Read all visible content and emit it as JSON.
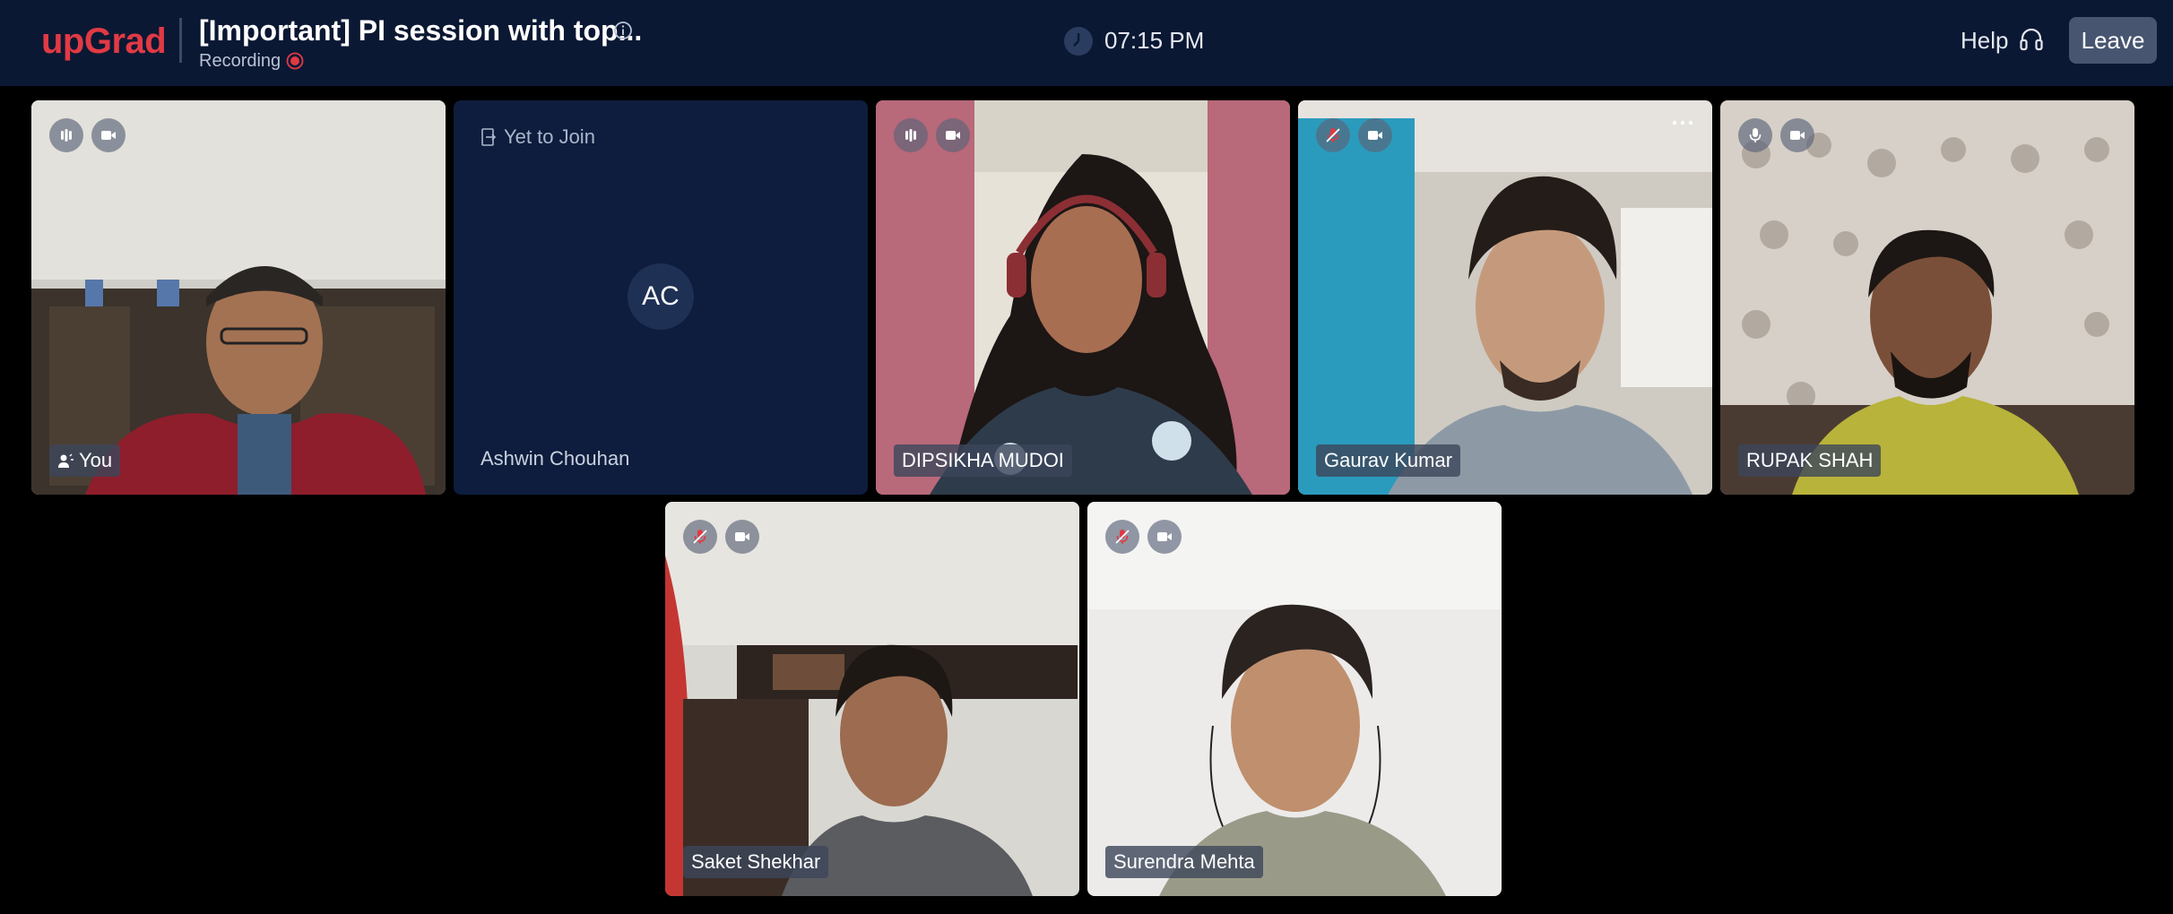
{
  "app": {
    "logo_text": "upGrad",
    "session_title": "[Important] PI session with top...",
    "recording_label": "Recording",
    "time": "07:15 PM",
    "help_label": "Help",
    "leave_label": "Leave"
  },
  "colors": {
    "topbar_bg": "#0b1833",
    "brand_red": "#e13a44",
    "leave_bg": "#475570",
    "tile_empty_bg": "#0e1d3d"
  },
  "participants": [
    {
      "name": "You",
      "mic": "active",
      "camera": "on",
      "is_self": true
    },
    {
      "name": "Ashwin Chouhan",
      "status": "Yet to Join",
      "initials": "AC"
    },
    {
      "name": "DIPSIKHA MUDOI",
      "mic": "active",
      "camera": "on"
    },
    {
      "name": "Gaurav Kumar",
      "mic": "muted",
      "camera": "on"
    },
    {
      "name": "RUPAK SHAH",
      "mic": "on",
      "camera": "on"
    },
    {
      "name": "Saket Shekhar",
      "mic": "muted",
      "camera": "on"
    },
    {
      "name": "Surendra Mehta",
      "mic": "muted",
      "camera": "on"
    }
  ],
  "icons": {
    "info": "info-icon",
    "recording": "record-dot-icon",
    "clock": "clock-icon",
    "help": "headset-icon",
    "audio_active": "audio-level-icon",
    "mic": "mic-icon",
    "mic_muted": "mic-muted-icon",
    "camera": "camera-icon",
    "more": "more-options-icon",
    "yet_to_join": "door-icon",
    "self": "user-icon"
  }
}
